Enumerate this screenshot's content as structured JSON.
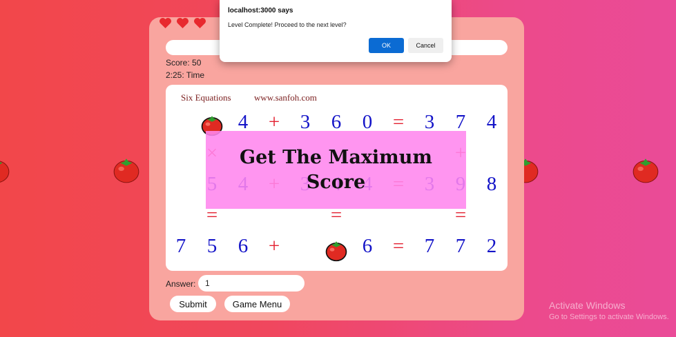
{
  "dialog": {
    "title": "localhost:3000 says",
    "message": "Level Complete! Proceed to the next level?",
    "ok_label": "OK",
    "cancel_label": "Cancel"
  },
  "game": {
    "lives": 3,
    "progress": 0,
    "score_text": "Score: 50",
    "time_text": "2:25: Time",
    "board": {
      "title_left": "Six Equations",
      "title_right": "www.sanfoh.com",
      "overlay_text": "Get The Maximum Score",
      "rows": [
        [
          "tomato",
          "4",
          "+",
          "3",
          "6",
          "0",
          "=",
          "3",
          "7",
          "4"
        ],
        [
          "",
          "×",
          "",
          "",
          "",
          "",
          "",
          "",
          "+",
          ""
        ],
        [
          "",
          "5",
          "4",
          "+",
          "3",
          "4",
          "4",
          "=",
          "3",
          "9",
          "8"
        ],
        [
          "",
          "=",
          "",
          "",
          "",
          "=",
          "",
          "",
          "",
          "=",
          ""
        ],
        [
          "7",
          "5",
          "6",
          "+",
          "",
          "tomato",
          "6",
          "=",
          "7",
          "7",
          "2"
        ]
      ]
    },
    "answer_label": "Answer:",
    "answer_value": "1",
    "submit_label": "Submit",
    "menu_label": "Game Menu"
  },
  "watermark": {
    "title": "Activate Windows",
    "subtitle": "Go to Settings to activate Windows."
  },
  "colors": {
    "digit": "#1414c8",
    "operator": "#e31e2e",
    "overlay": "#ff86ee",
    "card": "#f9a59f",
    "ok_button": "#0b6bd3"
  }
}
